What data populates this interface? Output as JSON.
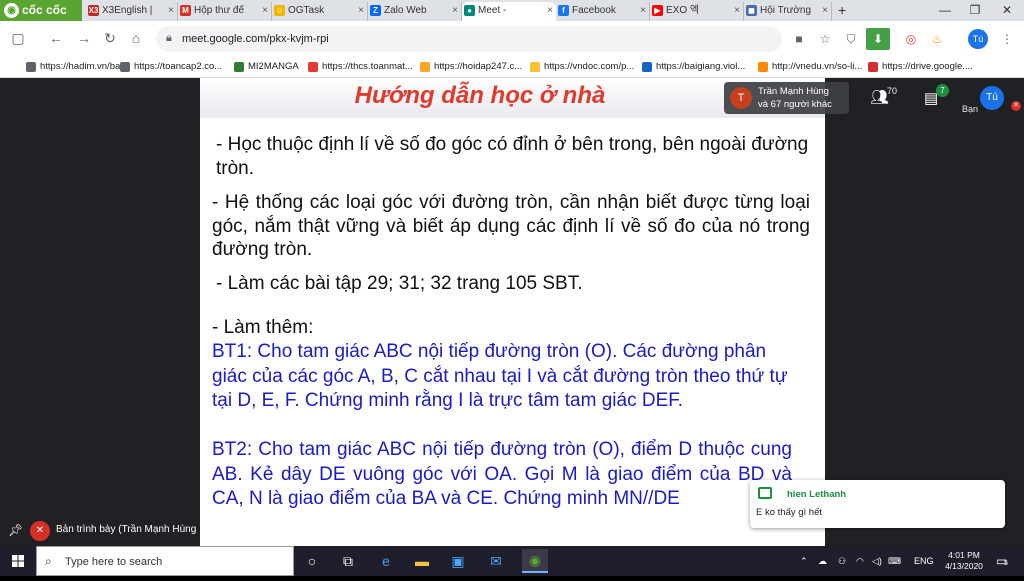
{
  "browser": {
    "brand": "cốc cốc",
    "tabs": [
      {
        "label": "X3English | ",
        "fav": "X3",
        "color": "#c62828"
      },
      {
        "label": "Hộp thư đế",
        "fav": "M",
        "color": "#d93025"
      },
      {
        "label": "OGTask",
        "fav": "☺",
        "color": "#f4b400"
      },
      {
        "label": "Zalo Web",
        "fav": "Z",
        "color": "#0068ff"
      },
      {
        "label": "Meet - ",
        "fav": "●",
        "color": "#00897b"
      },
      {
        "label": "Facebook",
        "fav": "f",
        "color": "#1877f2"
      },
      {
        "label": "EXO 엑",
        "fav": "▶",
        "color": "#ff0000"
      },
      {
        "label": "Hội Trường",
        "fav": "◼",
        "color": "#4a6da7"
      }
    ],
    "window_controls": [
      "—",
      "❐",
      "✕"
    ],
    "url": "meet.google.com/pkx-kvjm-rpi",
    "bookmarks": [
      {
        "label": "https://hadim.vn/bai...",
        "color": "#5f6368"
      },
      {
        "label": "https://toancap2.co...",
        "color": "#5f6368"
      },
      {
        "label": "MI2MANGA",
        "color": "#2e7d32"
      },
      {
        "label": "https://thcs.toanmat...",
        "color": "#e53935"
      },
      {
        "label": "https://hoidap247.c...",
        "color": "#f9a825"
      },
      {
        "label": "https://vndoc.com/p...",
        "color": "#fbc02d"
      },
      {
        "label": "https://baigiang.viol...",
        "color": "#1565c0"
      },
      {
        "label": "http://vnedu.vn/so-li...",
        "color": "#fb8c00"
      },
      {
        "label": "https://drive.google....",
        "color": "#d32f2f"
      }
    ]
  },
  "slide": {
    "title": "Hướng dẫn học ở nhà",
    "p1": "- Học thuộc định lí về số đo góc có đỉnh ở bên trong, bên ngoài đường tròn.",
    "p2": "- Hệ thống các loại góc với đường tròn, cần nhận biết được từng loại góc, nắm thật vững và biết áp dụng các định lí về số đo của nó trong đường tròn.",
    "p3": "- Làm  các bài tập 29; 31; 32 trang 105 SBT.",
    "p4": "-  Làm  thêm:",
    "bt1": "BT1: Cho tam giác ABC nội tiếp đường tròn (O). Các đường phân giác của các góc A, B, C cắt nhau tại I và cắt đường tròn theo thứ tự tại D, E, F. Chứng minh rằng I là trực tâm tam giác DEF.",
    "bt2": "BT2: Cho tam giác ABC nội tiếp đường tròn (O), điểm D thuộc cung AB. Kẻ dây DE vuông góc với OA. Gọi M là giao điểm của BD và CA, N là giao điểm của BA và CE. Chứng minh MN//DE"
  },
  "meet": {
    "presenter_initial": "T",
    "presenter_name": "Trần Mạnh Hùng",
    "presenter_others": "và 67 người khác",
    "people_count": "70",
    "chat_count": "7",
    "self_label": "Bạn",
    "self_initial": "Tú",
    "presenting_label": "Bản trình bày (Trần Mạnh Hùng",
    "chat_sender": "hien Lethanh",
    "chat_message": "E ko thấy gì hết"
  },
  "taskbar": {
    "search_placeholder": "Type here to search",
    "lang": "ENG",
    "time": "4:01 PM",
    "date": "4/13/2020",
    "notif_count": "5"
  }
}
